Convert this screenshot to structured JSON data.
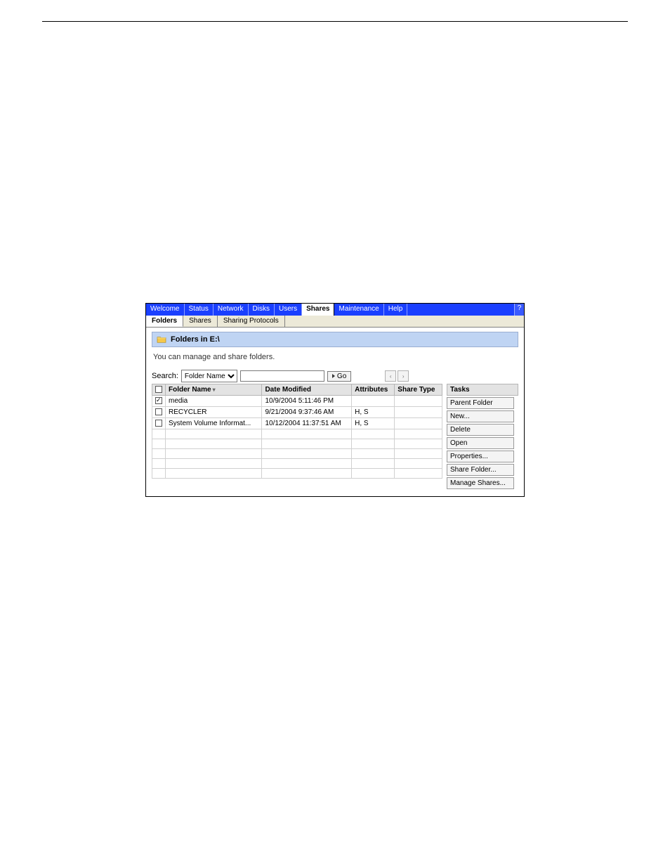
{
  "topnav": {
    "tabs": [
      "Welcome",
      "Status",
      "Network",
      "Disks",
      "Users",
      "Shares",
      "Maintenance",
      "Help"
    ],
    "active_index": 5,
    "help_icon": "?"
  },
  "subnav": {
    "tabs": [
      "Folders",
      "Shares",
      "Sharing Protocols"
    ],
    "active_index": 0
  },
  "panel": {
    "title": "Folders in E:\\",
    "description": "You can manage and share folders."
  },
  "search": {
    "label": "Search:",
    "options": [
      "Folder Name"
    ],
    "selected": "Folder Name",
    "value": "",
    "go_label": "Go"
  },
  "table": {
    "columns": [
      "Folder Name",
      "Date Modified",
      "Attributes",
      "Share Type"
    ],
    "sort_col": 0,
    "rows": [
      {
        "checked": true,
        "name": "media",
        "modified": "10/9/2004 5:11:46 PM",
        "attrs": "",
        "share": ""
      },
      {
        "checked": false,
        "name": "RECYCLER",
        "modified": "9/21/2004 9:37:46 AM",
        "attrs": "H, S",
        "share": ""
      },
      {
        "checked": false,
        "name": "System Volume Informat...",
        "modified": "10/12/2004 11:37:51 AM",
        "attrs": "H, S",
        "share": ""
      }
    ],
    "blank_rows": 5
  },
  "tasks": {
    "heading": "Tasks",
    "buttons": [
      "Parent Folder",
      "New...",
      "Delete",
      "Open",
      "Properties...",
      "Share Folder...",
      "Manage Shares..."
    ]
  }
}
